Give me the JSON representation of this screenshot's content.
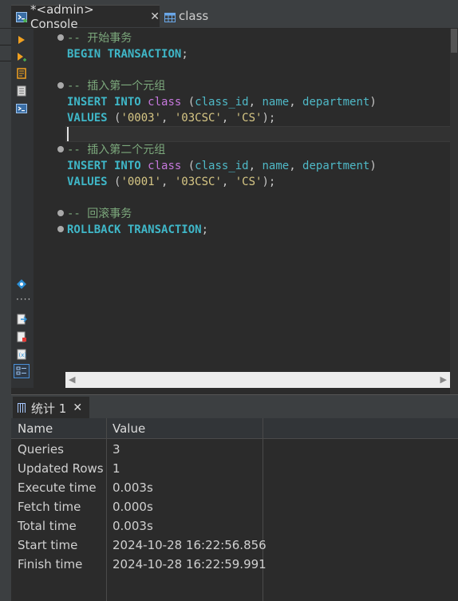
{
  "tabs": {
    "active": {
      "label": "*<admin> Console",
      "close": "✕"
    },
    "inactive": {
      "label": "class"
    }
  },
  "editor": {
    "lines": {
      "l1": "-- 开始事务",
      "l2a": "BEGIN",
      "l2b": " TRANSACTION",
      "l2c": ";",
      "l3": "-- 插入第一个元组",
      "l4_insert": "INSERT",
      "l4_into": " INTO",
      "l4_table": " class",
      "l4_open": " (",
      "l4_c1": "class_id",
      "l4_sep1": ", ",
      "l4_c2": "name",
      "l4_sep2": ", ",
      "l4_c3": "department",
      "l4_close": ")",
      "l5_values": "VALUES",
      "l5_open": " (",
      "l5_v1": "'0003'",
      "l5_sep1": ", ",
      "l5_v2": "'03CSC'",
      "l5_sep2": ", ",
      "l5_v3": "'CS'",
      "l5_close": ");",
      "l6": "-- 插入第二个元组",
      "l7_insert": "INSERT",
      "l7_into": " INTO",
      "l7_table": " class",
      "l7_open": " (",
      "l7_c1": "class_id",
      "l7_sep1": ", ",
      "l7_c2": "name",
      "l7_sep2": ", ",
      "l7_c3": "department",
      "l7_close": ")",
      "l8_values": "VALUES",
      "l8_open": " (",
      "l8_v1": "'0001'",
      "l8_sep1": ", ",
      "l8_v2": "'03CSC'",
      "l8_sep2": ", ",
      "l8_v3": "'CS'",
      "l8_close": ");",
      "l9": "-- 回滚事务",
      "l10a": "ROLLBACK",
      "l10b": " TRANSACTION",
      "l10c": ";"
    }
  },
  "results": {
    "tab_label": "统计 1",
    "tab_close": "✕",
    "headers": {
      "name": "Name",
      "value": "Value"
    },
    "rows": [
      {
        "name": "Queries",
        "value": "3"
      },
      {
        "name": "Updated Rows",
        "value": "1"
      },
      {
        "name": "Execute time",
        "value": "0.003s"
      },
      {
        "name": "Fetch time",
        "value": "0.000s"
      },
      {
        "name": "Total time",
        "value": "0.003s"
      },
      {
        "name": "Start time",
        "value": "2024-10-28 16:22:56.856"
      },
      {
        "name": "Finish time",
        "value": "2024-10-28 16:22:59.991"
      }
    ]
  },
  "scroll": {
    "left_arrow": "◀",
    "right_arrow": "▶"
  },
  "icons": {
    "console": "console-icon",
    "table": "table-icon",
    "execute": "execute-icon",
    "execute-script": "execute-script-icon",
    "explain": "explain-icon",
    "load-plan": "load-plan-icon",
    "console-toggle": "console-toggle-icon",
    "transaction": "transaction-icon",
    "more": "more-icon",
    "export": "export-icon",
    "export-pdf": "export-pdf-icon",
    "variables": "variables-icon",
    "outline": "outline-icon"
  },
  "colors": {
    "keyword": "#3fb7c8",
    "table_name": "#c678dd",
    "string": "#d7c785",
    "comment": "#7ca87c"
  }
}
